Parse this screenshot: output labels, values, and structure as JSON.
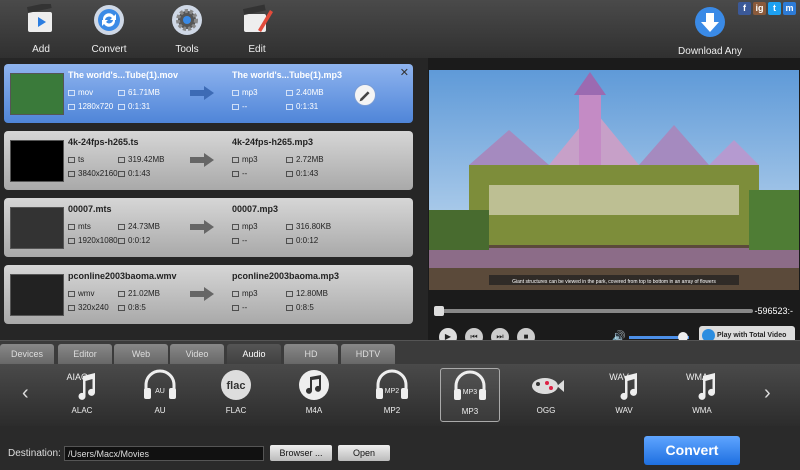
{
  "toolbar": {
    "add": "Add",
    "convert": "Convert",
    "tools": "Tools",
    "edit": "Edit",
    "download": "Download Any Video"
  },
  "social": [
    "f",
    "ig",
    "t",
    "m"
  ],
  "files": [
    {
      "name": "The world's...Tube(1).mov",
      "format": "mov",
      "size": "61.71MB",
      "resolution": "1280x720",
      "duration": "0:1:31",
      "out_name": "The world's...Tube(1).mp3",
      "out_format": "mp3",
      "out_size": "2.40MB",
      "out_res": "--",
      "out_duration": "0:1:31"
    },
    {
      "name": "4k-24fps-h265.ts",
      "format": "ts",
      "size": "319.42MB",
      "resolution": "3840x2160",
      "duration": "0:1:43",
      "out_name": "4k-24fps-h265.mp3",
      "out_format": "mp3",
      "out_size": "2.72MB",
      "out_res": "--",
      "out_duration": "0:1:43"
    },
    {
      "name": "00007.mts",
      "format": "mts",
      "size": "24.73MB",
      "resolution": "1920x1080",
      "duration": "0:0:12",
      "out_name": "00007.mp3",
      "out_format": "mp3",
      "out_size": "316.80KB",
      "out_res": "--",
      "out_duration": "0:0:12"
    },
    {
      "name": "pconline2003baoma.wmv",
      "format": "wmv",
      "size": "21.02MB",
      "resolution": "320x240",
      "duration": "0:8:5",
      "out_name": "pconline2003baoma.mp3",
      "out_format": "mp3",
      "out_size": "12.80MB",
      "out_res": "--",
      "out_duration": "0:8:5"
    }
  ],
  "preview": {
    "caption": "Giant structures can be viewed in the park, covered from top to bottom in an array of flowers",
    "time": "-596523:-",
    "play_total": "Play with Total Video Player",
    "volume": 0.9
  },
  "tabs": [
    "Devices",
    "Editor",
    "Web",
    "Video",
    "Audio",
    "HD",
    "HDTV"
  ],
  "active_tab": "Audio",
  "formats": [
    {
      "label": "ALAC",
      "glyph": "AIAC"
    },
    {
      "label": "AU",
      "glyph": "AU"
    },
    {
      "label": "FLAC",
      "glyph": "flac"
    },
    {
      "label": "M4A",
      "glyph": ""
    },
    {
      "label": "MP2",
      "glyph": "MP2"
    },
    {
      "label": "MP3",
      "glyph": "MP3"
    },
    {
      "label": "OGG",
      "glyph": ""
    },
    {
      "label": "WAV",
      "glyph": "WAV"
    },
    {
      "label": "WMA",
      "glyph": "WMA"
    }
  ],
  "selected_format": "MP3",
  "bottom": {
    "dest_label": "Destination:",
    "dest_value": "/Users/Macx/Movies",
    "browse": "Browser ...",
    "open": "Open",
    "convert": "Convert"
  },
  "colors": {
    "accent": "#2e7fe8",
    "selected_row": "#6b9be3"
  }
}
